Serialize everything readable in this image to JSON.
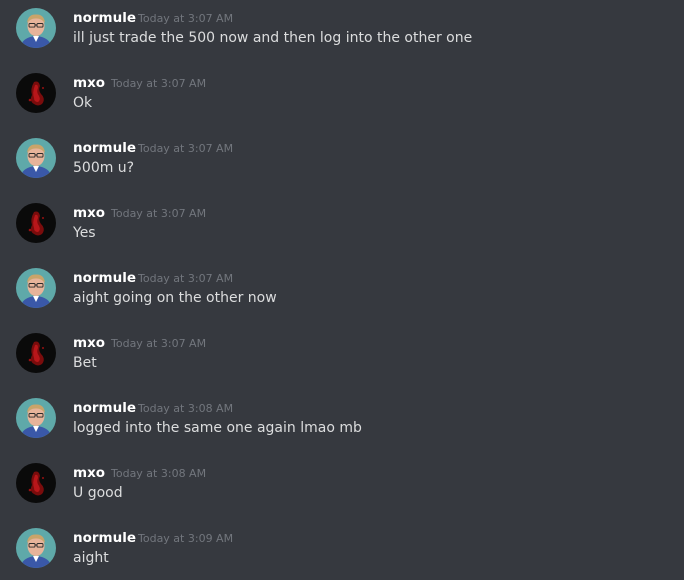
{
  "users": {
    "normule": {
      "name": "normule",
      "avatar_icon": "normule-avatar-icon",
      "avatar_bg": "#5fa9a9"
    },
    "mxo": {
      "name": "mxo",
      "avatar_icon": "mxo-avatar-icon",
      "avatar_bg": "#0a0a0a"
    }
  },
  "messages": [
    {
      "author": "normule",
      "time": "Today at 3:07 AM",
      "text": "ill just trade the 500 now and then log into the other one"
    },
    {
      "author": "mxo",
      "time": "Today at 3:07 AM",
      "text": "Ok"
    },
    {
      "author": "normule",
      "time": "Today at 3:07 AM",
      "text": "500m u?"
    },
    {
      "author": "mxo",
      "time": "Today at 3:07 AM",
      "text": "Yes"
    },
    {
      "author": "normule",
      "time": "Today at 3:07 AM",
      "text": "aight going on the other now"
    },
    {
      "author": "mxo",
      "time": "Today at 3:07 AM",
      "text": "Bet"
    },
    {
      "author": "normule",
      "time": "Today at 3:08 AM",
      "text": "logged into the same one again lmao mb"
    },
    {
      "author": "mxo",
      "time": "Today at 3:08 AM",
      "text": "U good"
    },
    {
      "author": "normule",
      "time": "Today at 3:09 AM",
      "text": "aight"
    }
  ],
  "colors": {
    "background": "#36393f",
    "username": "#ffffff",
    "timestamp": "#72767d",
    "message_text": "#dcddde"
  }
}
